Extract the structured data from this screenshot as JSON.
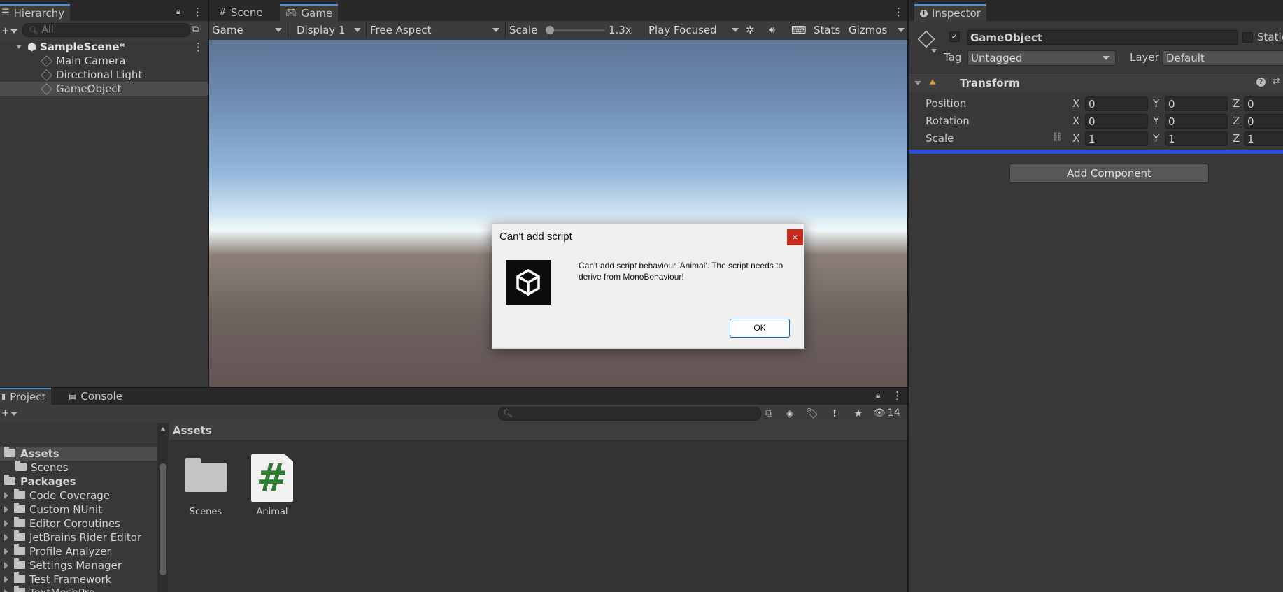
{
  "hierarchy": {
    "tab_label": "Hierarchy",
    "search_placeholder": "All",
    "scene_name": "SampleScene*",
    "items": [
      "Main Camera",
      "Directional Light",
      "GameObject"
    ]
  },
  "game_view": {
    "tabs": [
      "Scene",
      "Game"
    ],
    "toolbar": {
      "mode": "Game",
      "display": "Display 1",
      "aspect": "Free Aspect",
      "scale_label": "Scale",
      "scale_value": "1.3x",
      "play_mode": "Play Focused",
      "stats": "Stats",
      "gizmos": "Gizmos"
    }
  },
  "inspector": {
    "tab_label": "Inspector",
    "object_name": "GameObject",
    "static_label": "Static",
    "tag_label": "Tag",
    "tag_value": "Untagged",
    "layer_label": "Layer",
    "layer_value": "Default",
    "component_title": "Transform",
    "rows": [
      {
        "label": "Position",
        "x": "0",
        "y": "0",
        "z": "0"
      },
      {
        "label": "Rotation",
        "x": "0",
        "y": "0",
        "z": "0"
      },
      {
        "label": "Scale",
        "x": "1",
        "y": "1",
        "z": "1"
      }
    ],
    "axis": [
      "X",
      "Y",
      "Z"
    ],
    "add_component": "Add Component"
  },
  "project": {
    "tabs": [
      "Project",
      "Console"
    ],
    "hidden_count": "14",
    "breadcrumb": "Assets",
    "tree": {
      "assets": "Assets",
      "scenes": "Scenes",
      "packages": "Packages",
      "package_items": [
        "Code Coverage",
        "Custom NUnit",
        "Editor Coroutines",
        "JetBrains Rider Editor",
        "Profile Analyzer",
        "Settings Manager",
        "Test Framework",
        "TextMeshPro"
      ]
    },
    "grid_items": [
      {
        "label": "Scenes",
        "icon": "folder-icon"
      },
      {
        "label": "Animal",
        "icon": "csharp-script-icon"
      }
    ]
  },
  "dialog": {
    "title": "Can't add script",
    "close": "×",
    "message": "Can't add script behaviour 'Animal'. The script needs to derive from MonoBehaviour!",
    "ok": "OK"
  },
  "colors": {
    "accent": "#4f8fdc",
    "selection_bar": "#2a4dd1",
    "close_button": "#c42b1c",
    "script_hash": "#2e7d32"
  }
}
